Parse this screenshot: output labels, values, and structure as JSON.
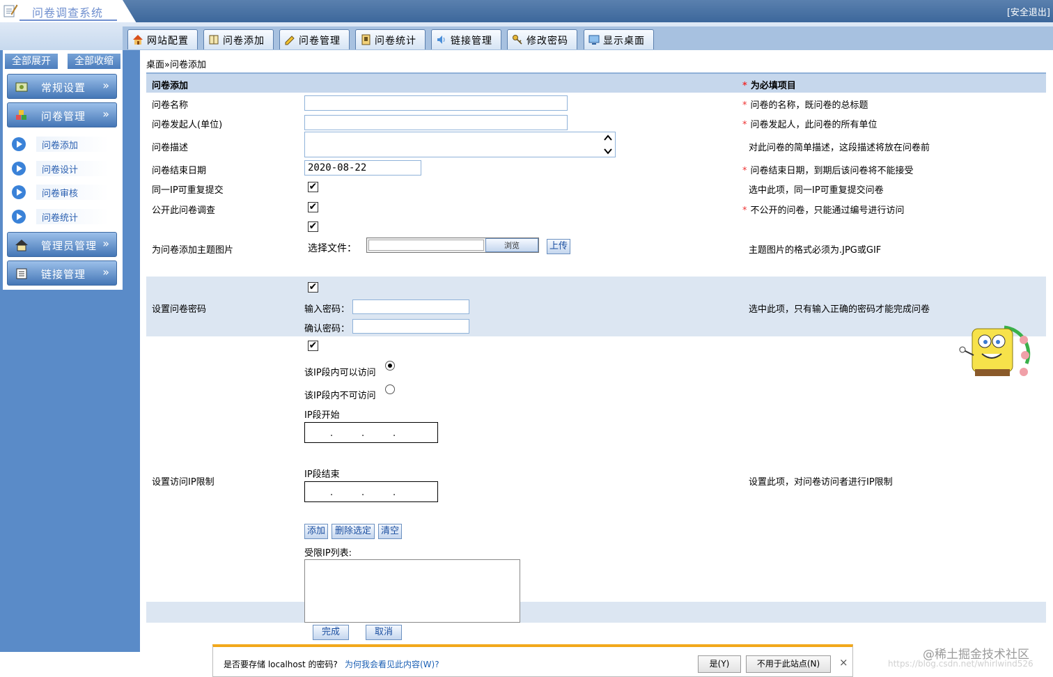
{
  "app": {
    "title": "问卷调查系统",
    "logout": "[安全退出]"
  },
  "tabs": [
    {
      "label": "网站配置",
      "icon": "house-icon"
    },
    {
      "label": "问卷添加",
      "icon": "book-icon"
    },
    {
      "label": "问卷管理",
      "icon": "pencil-icon"
    },
    {
      "label": "问卷统计",
      "icon": "document-icon"
    },
    {
      "label": "链接管理",
      "icon": "speaker-icon"
    },
    {
      "label": "修改密码",
      "icon": "key-icon"
    },
    {
      "label": "显示桌面",
      "icon": "desktop-icon"
    }
  ],
  "sidebar": {
    "expand_all": "全部展开",
    "collapse_all": "全部收缩",
    "chevron": "»",
    "menus": [
      {
        "label": "常规设置",
        "icon": "settings-icon"
      },
      {
        "label": "问卷管理",
        "icon": "cubes-icon"
      },
      {
        "label": "管理员管理",
        "icon": "admin-house-icon"
      },
      {
        "label": "链接管理",
        "icon": "list-icon"
      }
    ],
    "sub_items": [
      "问卷添加",
      "问卷设计",
      "问卷审核",
      "问卷统计"
    ]
  },
  "breadcrumb": "桌面»问卷添加",
  "form": {
    "header": {
      "title": "问卷添加",
      "required_note": "为必填项目"
    },
    "name": {
      "label": "问卷名称",
      "value": "",
      "hint": "问卷的名称，既问卷的总标题"
    },
    "initiator": {
      "label": "问卷发起人(单位)",
      "value": "",
      "hint": "问卷发起人，此问卷的所有单位"
    },
    "description": {
      "label": "问卷描述",
      "value": "",
      "hint": "对此问卷的简单描述，这段描述将放在问卷前"
    },
    "end_date": {
      "label": "问卷结束日期",
      "value": "2020-08-22",
      "hint": "问卷结束日期，到期后该问卷将不能接受"
    },
    "same_ip": {
      "label": "同一IP可重复提交",
      "checked": true,
      "hint": "选中此项，同一IP可重复提交问卷"
    },
    "public": {
      "label": "公开此问卷调查",
      "checked": true,
      "hint": "不公开的问卷，只能通过编号进行访问"
    },
    "theme_image": {
      "label": "为问卷添加主题图片",
      "checked": true,
      "file_label": "选择文件：",
      "browse": "浏览",
      "upload": "上传",
      "hint": "主题图片的格式必须为.JPG或GIF"
    },
    "password": {
      "label": "设置问卷密码",
      "checked": true,
      "enter_label": "输入密码：",
      "confirm_label": "确认密码：",
      "hint": "选中此项，只有输入正确的密码才能完成问卷"
    },
    "ip_limit": {
      "label": "设置访问IP限制",
      "checked": true,
      "allow_label": "该IP段内可以访问",
      "deny_label": "该IP段内不可访问",
      "selected": "allow",
      "start_label": "IP段开始",
      "end_label": "IP段结束",
      "dot": ".",
      "add": "添加",
      "delete_selected": "删除选定",
      "clear": "清空",
      "list_label": "受限IP列表:",
      "hint": "设置此项，对问卷访问者进行IP限制"
    },
    "finish": "完成",
    "cancel": "取消"
  },
  "password_prompt": {
    "question": "是否要存储 localhost 的密码?",
    "link": "为何我会看见此内容(W)?",
    "yes": "是(Y)",
    "never": "不用于此站点(N)",
    "close": "×"
  },
  "watermark": {
    "main": "@稀土掘金技术社区",
    "sub": "https://blog.csdn.net/whirlwind526"
  },
  "colors": {
    "header": "#3c679b",
    "sidebar": "#5a8bc8",
    "band": "#dce6f2",
    "required": "#ee3333",
    "accent": "#f2a81c"
  }
}
